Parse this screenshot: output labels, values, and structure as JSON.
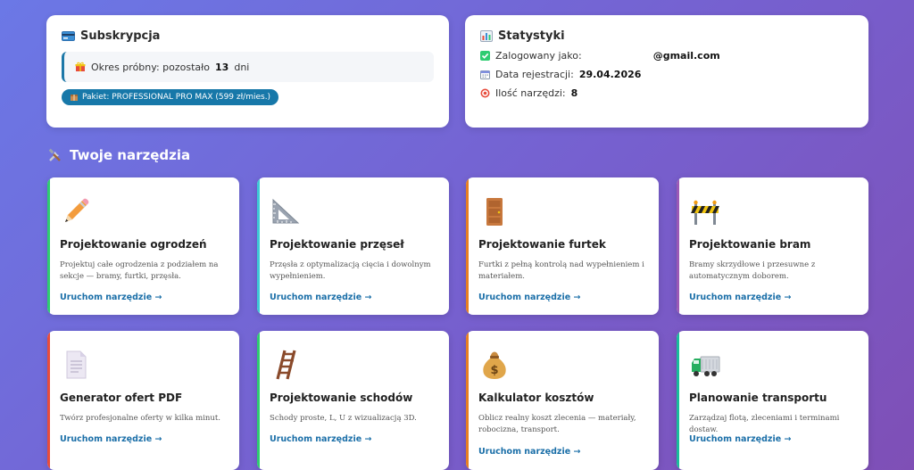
{
  "subscription": {
    "title": "Subskrypcja",
    "trial_prefix": "Okres próbny: pozostało",
    "trial_days": "13",
    "trial_suffix": "dni",
    "plan_label": "Pakiet: PROFESSIONAL PRO MAX (599 zł/mies.)"
  },
  "stats": {
    "title": "Statystyki",
    "logged_label": "Zalogowany jako:",
    "logged_value": "@gmail.com",
    "reg_label": "Data rejestracji:",
    "reg_value": "29.04.2026",
    "tools_label": "Ilość narzędzi:",
    "tools_value": "8"
  },
  "tools_section": {
    "title": "Twoje narzędzia"
  },
  "colors": {
    "link": "#1b6fa8",
    "badge": "#1778a9",
    "accent_green": "#2ecc71",
    "accent_cyan": "#3ec9d6",
    "accent_orange": "#e67e22",
    "accent_purple": "#9b59b6",
    "accent_red": "#e74c3c",
    "accent_teal": "#1abc9c"
  },
  "cards": [
    {
      "title": "Projektowanie ogrodzeń",
      "desc": "Projektuj całe ogrodzenia z podziałem na sekcje — bramy, furtki, przęsła.",
      "link": "Uruchom narzędzie →",
      "icon": "pencil-icon"
    },
    {
      "title": "Projektowanie przęseł",
      "desc": "Przęsła z optymalizacją cięcia i dowolnym wypełnieniem.",
      "link": "Uruchom narzędzie →",
      "icon": "triangle-ruler-icon"
    },
    {
      "title": "Projektowanie furtek",
      "desc": "Furtki z pełną kontrolą nad wypełnieniem i materiałem.",
      "link": "Uruchom narzędzie →",
      "icon": "door-icon"
    },
    {
      "title": "Projektowanie bram",
      "desc": "Bramy skrzydłowe i przesuwne z automatycznym doborem.",
      "link": "Uruchom narzędzie →",
      "icon": "barrier-icon"
    },
    {
      "title": "Generator ofert PDF",
      "desc": "Twórz profesjonalne oferty w kilka minut.",
      "link": "Uruchom narzędzie →",
      "icon": "document-icon"
    },
    {
      "title": "Projektowanie schodów",
      "desc": "Schody proste, L, U z wizualizacją 3D.",
      "link": "Uruchom narzędzie →",
      "icon": "ladder-icon"
    },
    {
      "title": "Kalkulator kosztów",
      "desc": "Oblicz realny koszt zlecenia — materiały, robocizna, transport.",
      "link": "Uruchom narzędzie →",
      "icon": "money-bag-icon"
    },
    {
      "title": "Planowanie transportu",
      "desc": "Zarządzaj flotą, zleceniami i terminami dostaw.",
      "link": "Uruchom narzędzie →",
      "icon": "truck-icon"
    }
  ]
}
